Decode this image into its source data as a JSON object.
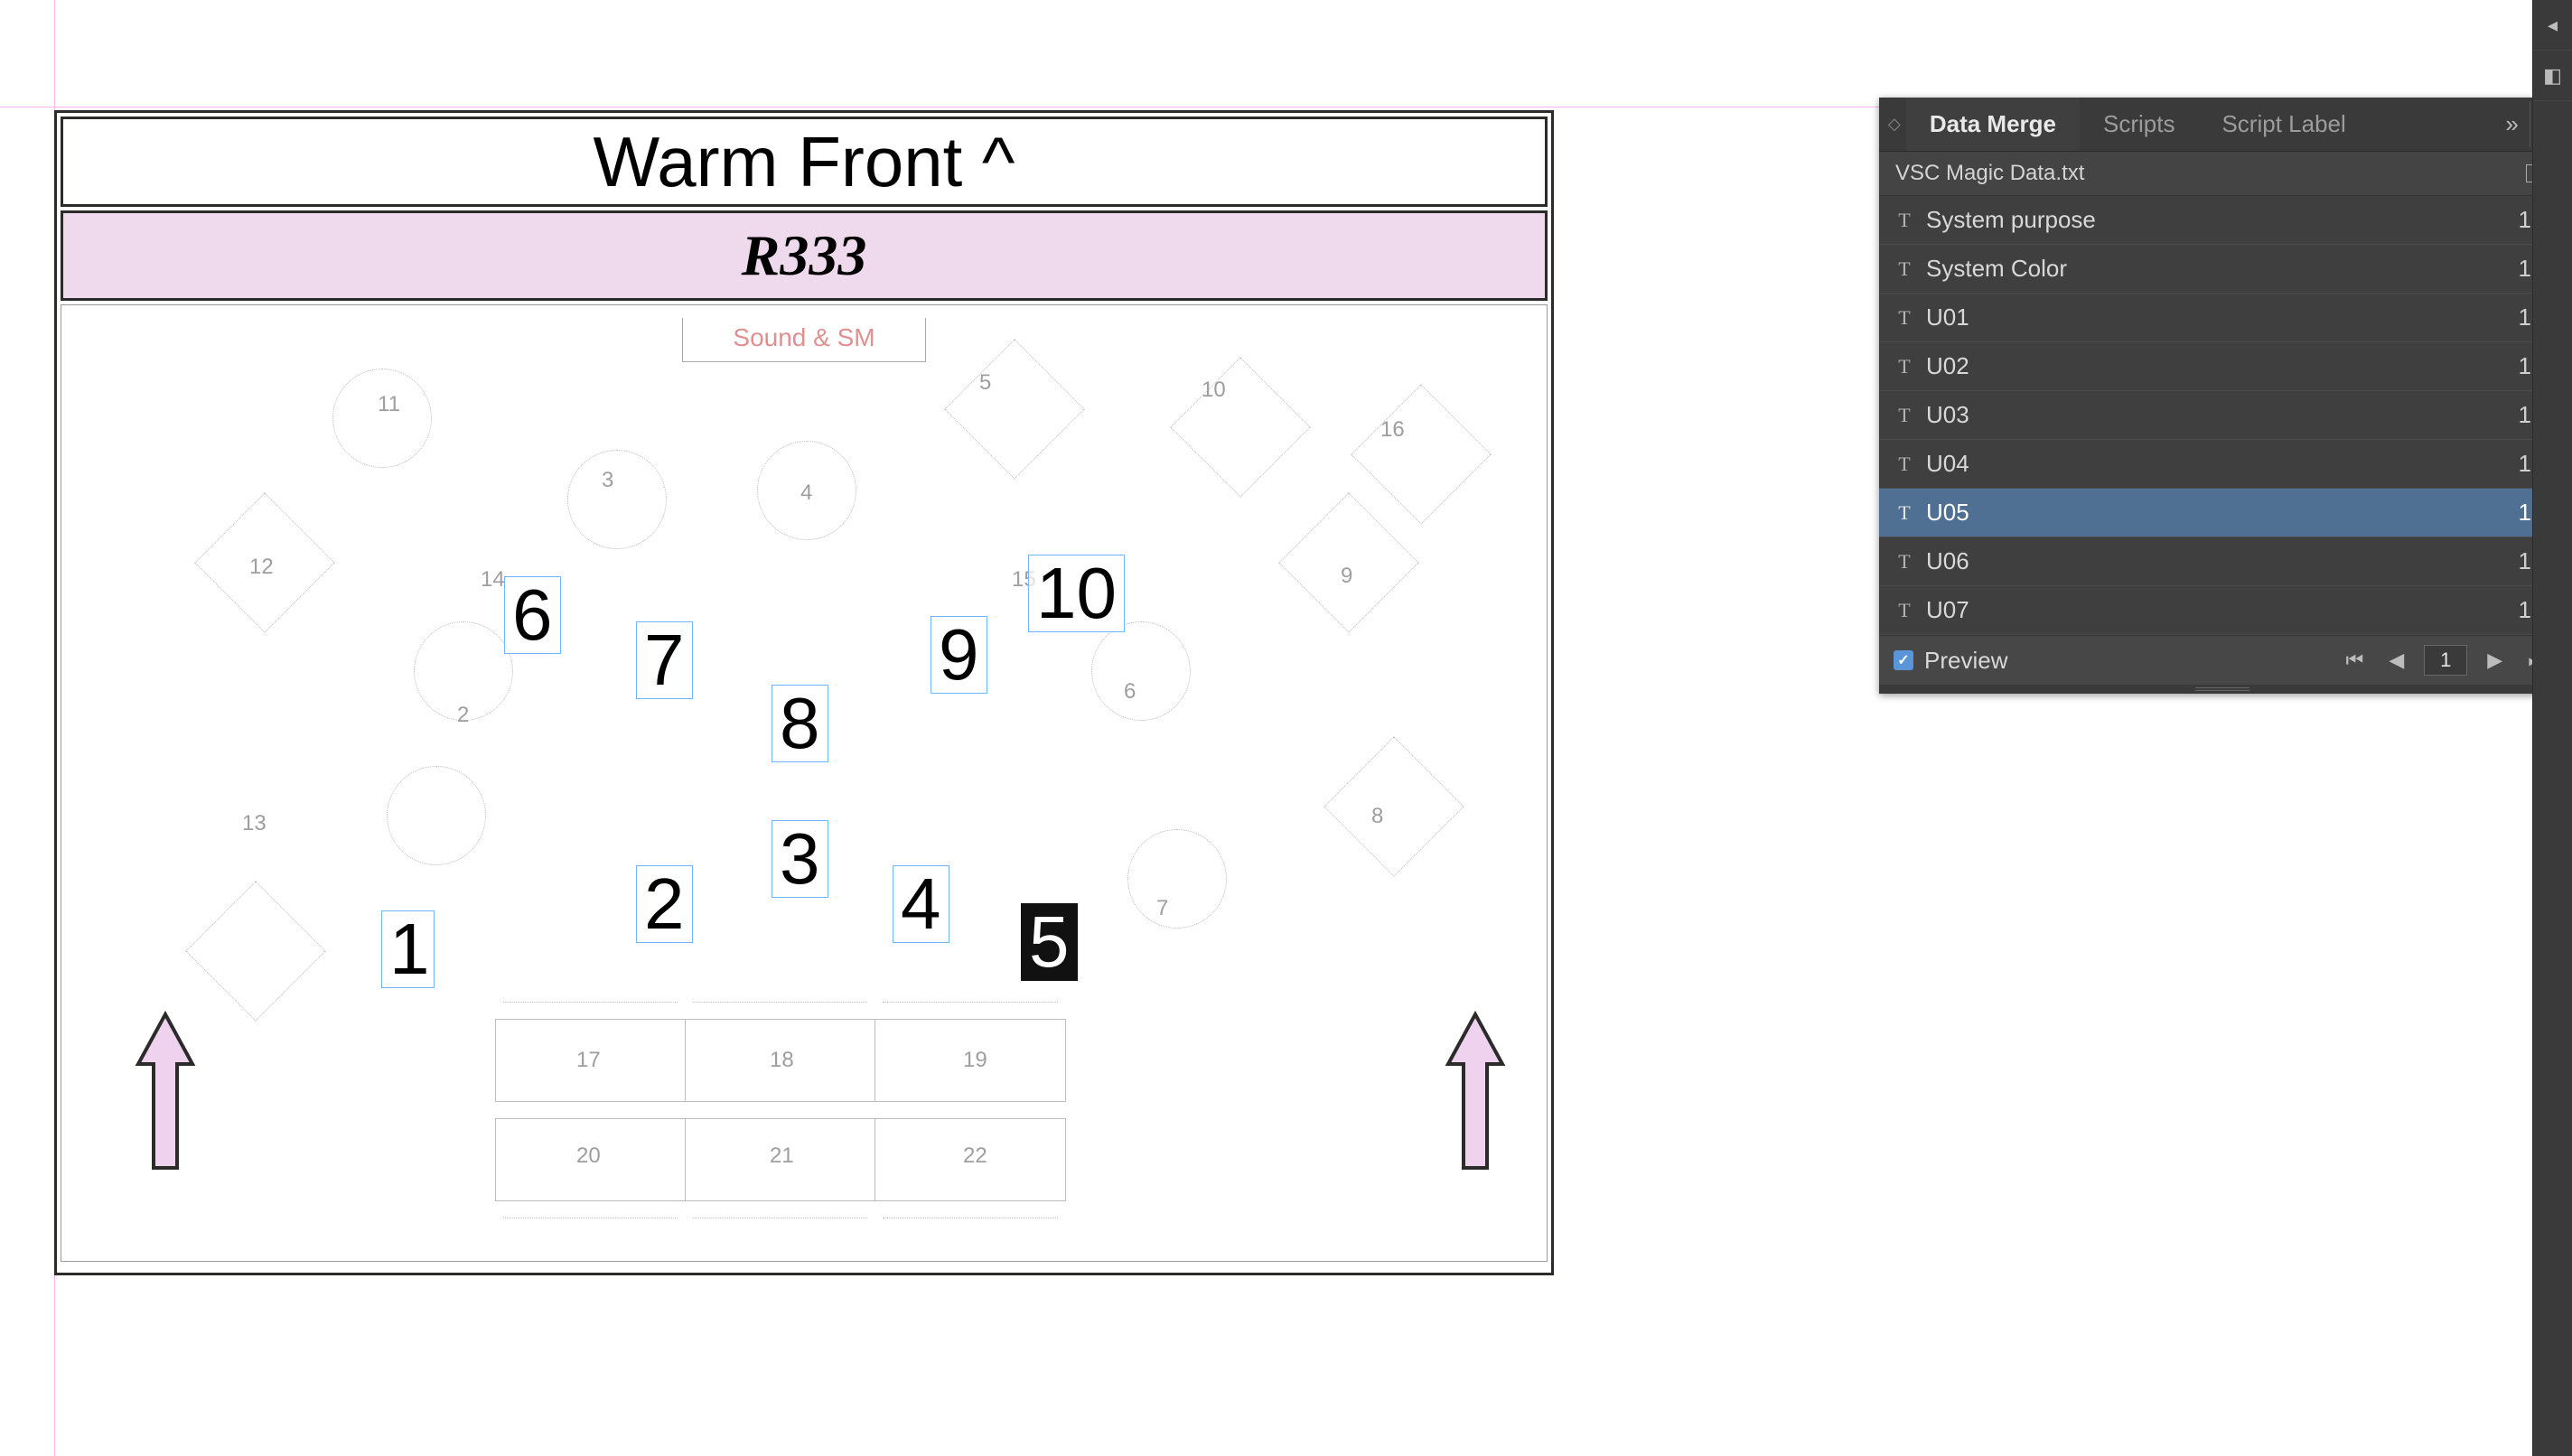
{
  "document": {
    "title": "Warm Front ^",
    "subtitle": "R333",
    "sound_label": "Sound & SM",
    "small_table_numbers": [
      "11",
      "5",
      "10",
      "16",
      "3",
      "4",
      "12",
      "14",
      "15",
      "9",
      "2",
      "6",
      "7",
      "13",
      "8",
      "17",
      "18",
      "19",
      "20",
      "21",
      "22"
    ],
    "big_units": {
      "u01": "1",
      "u02": "2",
      "u03": "3",
      "u04": "4",
      "u05": "5",
      "u06": "6",
      "u07": "7",
      "u08": "8",
      "u09": "9",
      "u10": "10"
    }
  },
  "panel": {
    "tabs": {
      "data_merge": "Data Merge",
      "scripts": "Scripts",
      "script_label": "Script Label"
    },
    "collapse_glyph": "»",
    "menu_glyph": "≡",
    "file_name": "VSC Magic Data.txt",
    "fields": [
      {
        "name": "System purpose",
        "count": "1"
      },
      {
        "name": "System Color",
        "count": "1"
      },
      {
        "name": "U01",
        "count": "1"
      },
      {
        "name": "U02",
        "count": "1"
      },
      {
        "name": "U03",
        "count": "1"
      },
      {
        "name": "U04",
        "count": "1"
      },
      {
        "name": "U05",
        "count": "1",
        "selected": true
      },
      {
        "name": "U06",
        "count": "1"
      },
      {
        "name": "U07",
        "count": "1"
      }
    ],
    "preview_label": "Preview",
    "preview_checked": true,
    "page_value": "1",
    "pager_first": "⏮",
    "pager_prev": "◀",
    "pager_next": "▶",
    "pager_last": "⏭"
  }
}
